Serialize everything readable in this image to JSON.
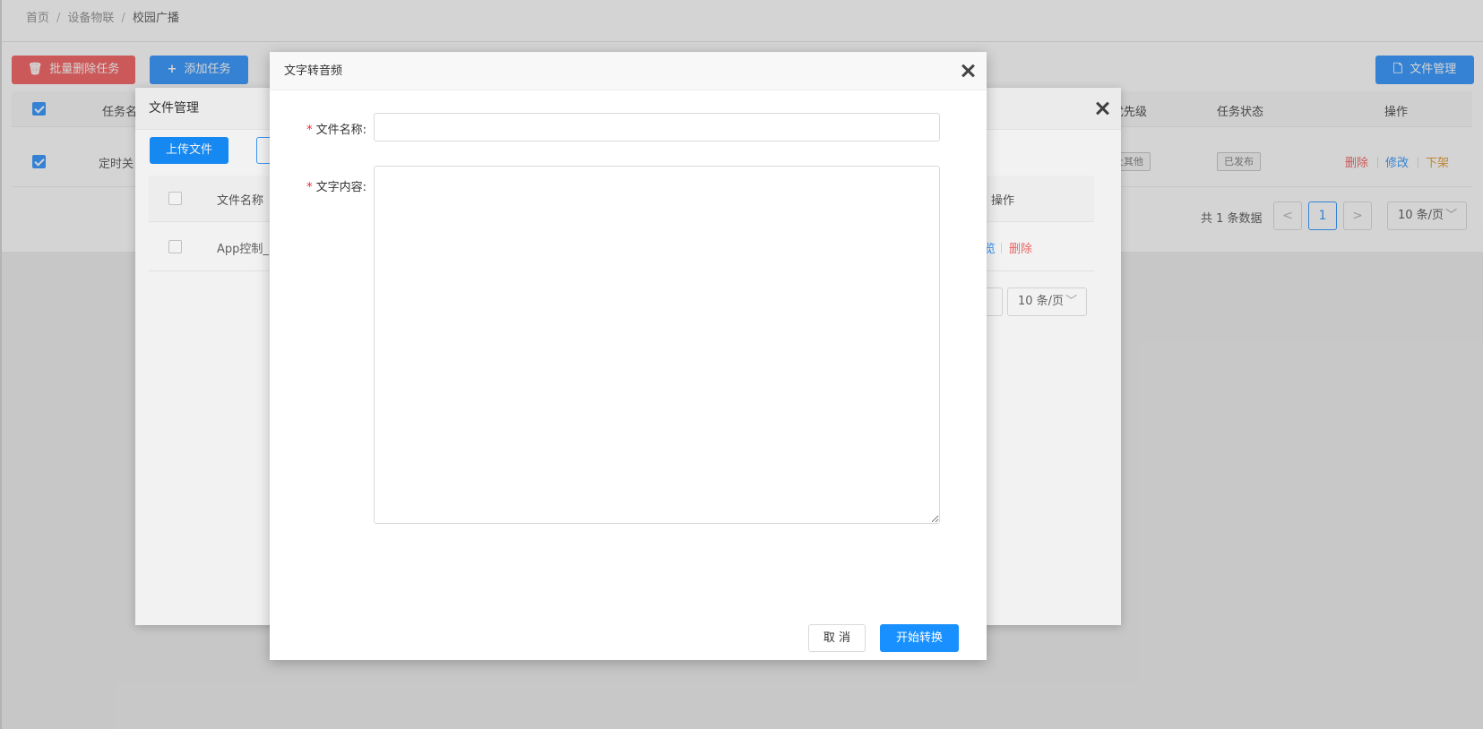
{
  "breadcrumb": {
    "home": "首页",
    "section": "设备物联",
    "current": "校园广播"
  },
  "toolbar": {
    "batch_delete": "批量删除任务",
    "add_task": "添加任务",
    "file_manage": "文件管理"
  },
  "task_table": {
    "headers": {
      "name": "任务名",
      "priority": "优先级",
      "status": "任务状态",
      "actions": "操作"
    },
    "row": {
      "name": "定时关",
      "priority": "止其他",
      "status": "已发布",
      "delete": "删除",
      "edit": "修改",
      "unpublish": "下架"
    }
  },
  "pagination": {
    "total": "共 1 条数据",
    "prev": "<",
    "page": "1",
    "next": ">",
    "size": "10 条/页"
  },
  "file_dialog": {
    "title": "文件管理",
    "upload": "上传文件",
    "headers": {
      "name": "文件名称",
      "actions": "操作"
    },
    "row": {
      "name": "App控制_",
      "preview": "览",
      "delete": "删除"
    },
    "page_size": "10 条/页"
  },
  "tts_dialog": {
    "title": "文字转音频",
    "required_mark": "*",
    "file_name_label": "文件名称:",
    "file_name_value": "",
    "content_label": "文字内容:",
    "content_value": "",
    "cancel": "取 消",
    "submit": "开始转换"
  },
  "colors": {
    "danger": "#f56c6c",
    "primary": "#409eff",
    "submit": "#1890ff",
    "required": "#f5222d"
  }
}
